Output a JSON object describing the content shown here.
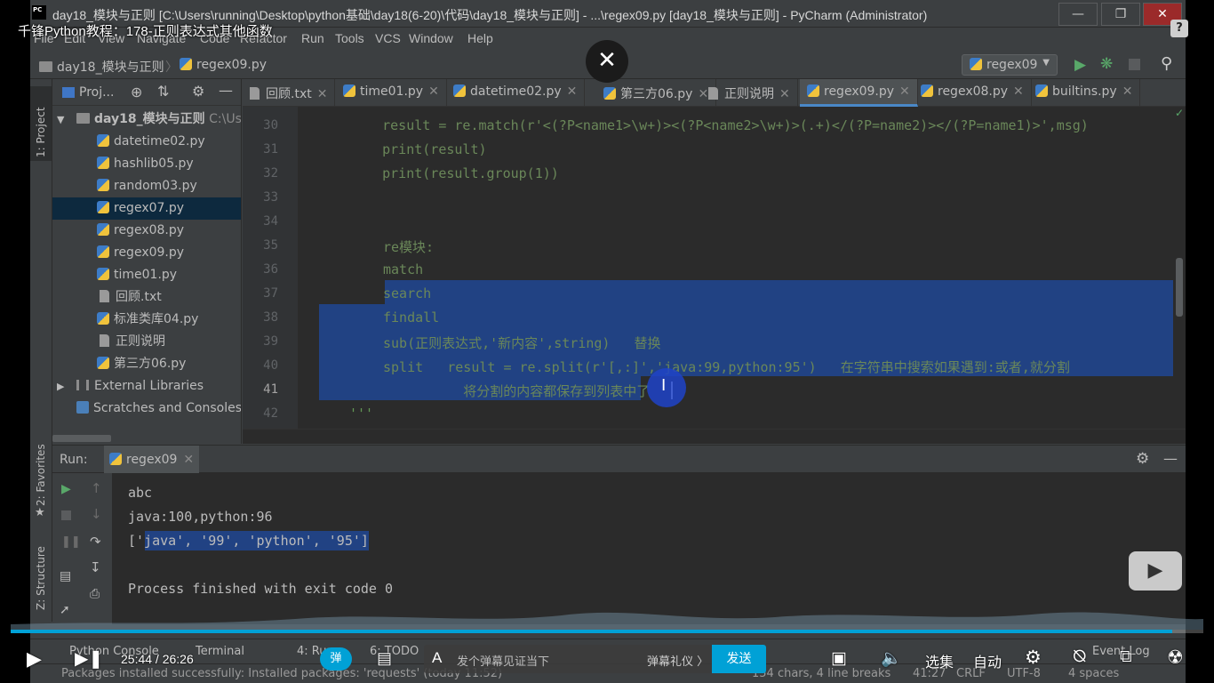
{
  "window": {
    "title": "day18_模块与正则 [C:\\Users\\running\\Desktop\\python基础\\day18(6-20)\\代码\\day18_模块与正则] - ...\\regex09.py [day18_模块与正则] - PyCharm (Administrator)",
    "app_icon": "PC"
  },
  "video": {
    "title": "千锋Python教程：178-正则表达式其他函数",
    "close_glyph": "✕",
    "time": "25:44 / 26:26",
    "progress": 0.974,
    "danmu_badge": "弹",
    "danmu_placeholder": "发个弹幕见证当下",
    "danmu_etiquette": "弹幕礼仪 〉",
    "send": "发送",
    "episodes": "选集",
    "quality": "自动"
  },
  "menu": [
    "File",
    "Edit",
    "View",
    "Navigate",
    "Code",
    "Refactor",
    "Run",
    "Tools",
    "VCS",
    "Window",
    "Help"
  ],
  "nav": {
    "project": "day18_模块与正则",
    "file": "regex09.py",
    "run_config": "regex09"
  },
  "left_stripe": {
    "project_tab": "1: Project",
    "favorites_tab": "2: Favorites",
    "structure_tab": "Z: Structure"
  },
  "project_panel": {
    "title": "Proj...",
    "root": "day18_模块与正则",
    "root_path": "C:\\Use",
    "files": [
      {
        "name": "datetime02.py",
        "type": "py"
      },
      {
        "name": "hashlib05.py",
        "type": "py"
      },
      {
        "name": "random03.py",
        "type": "py"
      },
      {
        "name": "regex07.py",
        "type": "py"
      },
      {
        "name": "regex08.py",
        "type": "py"
      },
      {
        "name": "regex09.py",
        "type": "py"
      },
      {
        "name": "time01.py",
        "type": "py"
      },
      {
        "name": "回顾.txt",
        "type": "txt"
      },
      {
        "name": "标准类库04.py",
        "type": "py"
      },
      {
        "name": "正则说明",
        "type": "txt"
      },
      {
        "name": "第三方06.py",
        "type": "py"
      }
    ],
    "external": "External Libraries",
    "scratches": "Scratches and Consoles"
  },
  "tabs": [
    {
      "label": "回顾.txt",
      "type": "txt"
    },
    {
      "label": "time01.py",
      "type": "py"
    },
    {
      "label": "datetime02.py",
      "type": "py"
    },
    {
      "label": "第三方06.py",
      "type": "py"
    },
    {
      "label": "正则说明",
      "type": "txt"
    },
    {
      "label": "regex09.py",
      "type": "py"
    },
    {
      "label": "regex08.py",
      "type": "py"
    },
    {
      "label": "builtins.py",
      "type": "py"
    }
  ],
  "editor": {
    "lines": [
      {
        "n": "30",
        "text": "    result = re.match(r'<(?P<name1>\\w+)><(?P<name2>\\w+)>(.+)</(?P=name2)></(?P=name1)>',msg)"
      },
      {
        "n": "31",
        "text": "    print(result)"
      },
      {
        "n": "32",
        "text": "    print(result.group(1))"
      },
      {
        "n": "33",
        "text": ""
      },
      {
        "n": "34",
        "text": ""
      },
      {
        "n": "35",
        "text": "re模块:"
      },
      {
        "n": "36",
        "text": "match"
      },
      {
        "n": "37",
        "text": "search"
      },
      {
        "n": "38",
        "text": "findall"
      },
      {
        "n": "39",
        "text": "sub(正则表达式,'新内容',string)   替换"
      },
      {
        "n": "40",
        "text": "split   result = re.split(r'[,:]','java:99,python:95')   在字符串中搜索如果遇到:或者,就分割"
      },
      {
        "n": "41",
        "text": "          将分割的内容都保存到列表中了"
      },
      {
        "n": "42",
        "text": "'''"
      }
    ]
  },
  "run": {
    "label": "Run:",
    "tab": "regex09",
    "output": [
      "abc",
      "java:100,python:96",
      "['java', '99', 'python', '95']",
      "",
      "Process finished with exit code 0"
    ]
  },
  "bottom_tabs": [
    "Python Console",
    "Terminal",
    "4: Run",
    "6: TODO",
    "Event Log"
  ],
  "status": {
    "message": "Packages installed successfully: Installed packages: 'requests' (today 11:52)",
    "selection": "154 chars, 4 line breaks",
    "position": "41:27",
    "line_sep": "CRLF",
    "encoding": "UTF-8",
    "indent": "4 spaces"
  },
  "colors": {
    "ide_bg": "#3c3f41",
    "editor_bg": "#2b2b2b",
    "selection": "#214283",
    "accent": "#00a1d6"
  }
}
